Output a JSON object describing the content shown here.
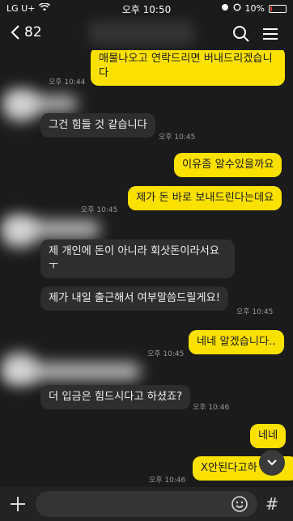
{
  "status_bar": {
    "carrier": "LG U+",
    "time": "오후 10:50",
    "battery": "10%",
    "battery_level": 0.1
  },
  "header": {
    "back_count": "82"
  },
  "messages": [
    {
      "from": "me",
      "text": "매물나오고 연락드리면 버내드리겠습니다"
    },
    {
      "from": "them",
      "time": "오후 10:44"
    },
    {
      "from": "them",
      "text": "그건 힘들 것 같습니다",
      "time": "오후 10:45"
    },
    {
      "from": "me",
      "text": "이유좀 알수있을까요"
    },
    {
      "from": "me",
      "text": "제가 돈 바로 보내드린다는데요",
      "time": "오후 10:45"
    },
    {
      "from": "them",
      "text": "제 개인에 돈이 아니라 회삿돈이라서요ㅜ"
    },
    {
      "from": "them",
      "text": "제가 내일 출근해서 여부말씀드릴게요!",
      "time": "오후 10:45"
    },
    {
      "from": "me",
      "text": "네네 알겠습니다..",
      "time": "오후 10:45"
    },
    {
      "from": "them",
      "text": "더 입금은 힘드시다고 하셨죠?",
      "time": "오후 10:46"
    },
    {
      "from": "me",
      "text": "네네"
    },
    {
      "from": "me",
      "text": "X안된다고하",
      "time": "오후 10:46"
    }
  ],
  "input": {
    "placeholder": ""
  },
  "colors": {
    "my_bubble": "#fae100",
    "their_bubble": "#2e2e2e",
    "background": "#1b1b1b"
  }
}
